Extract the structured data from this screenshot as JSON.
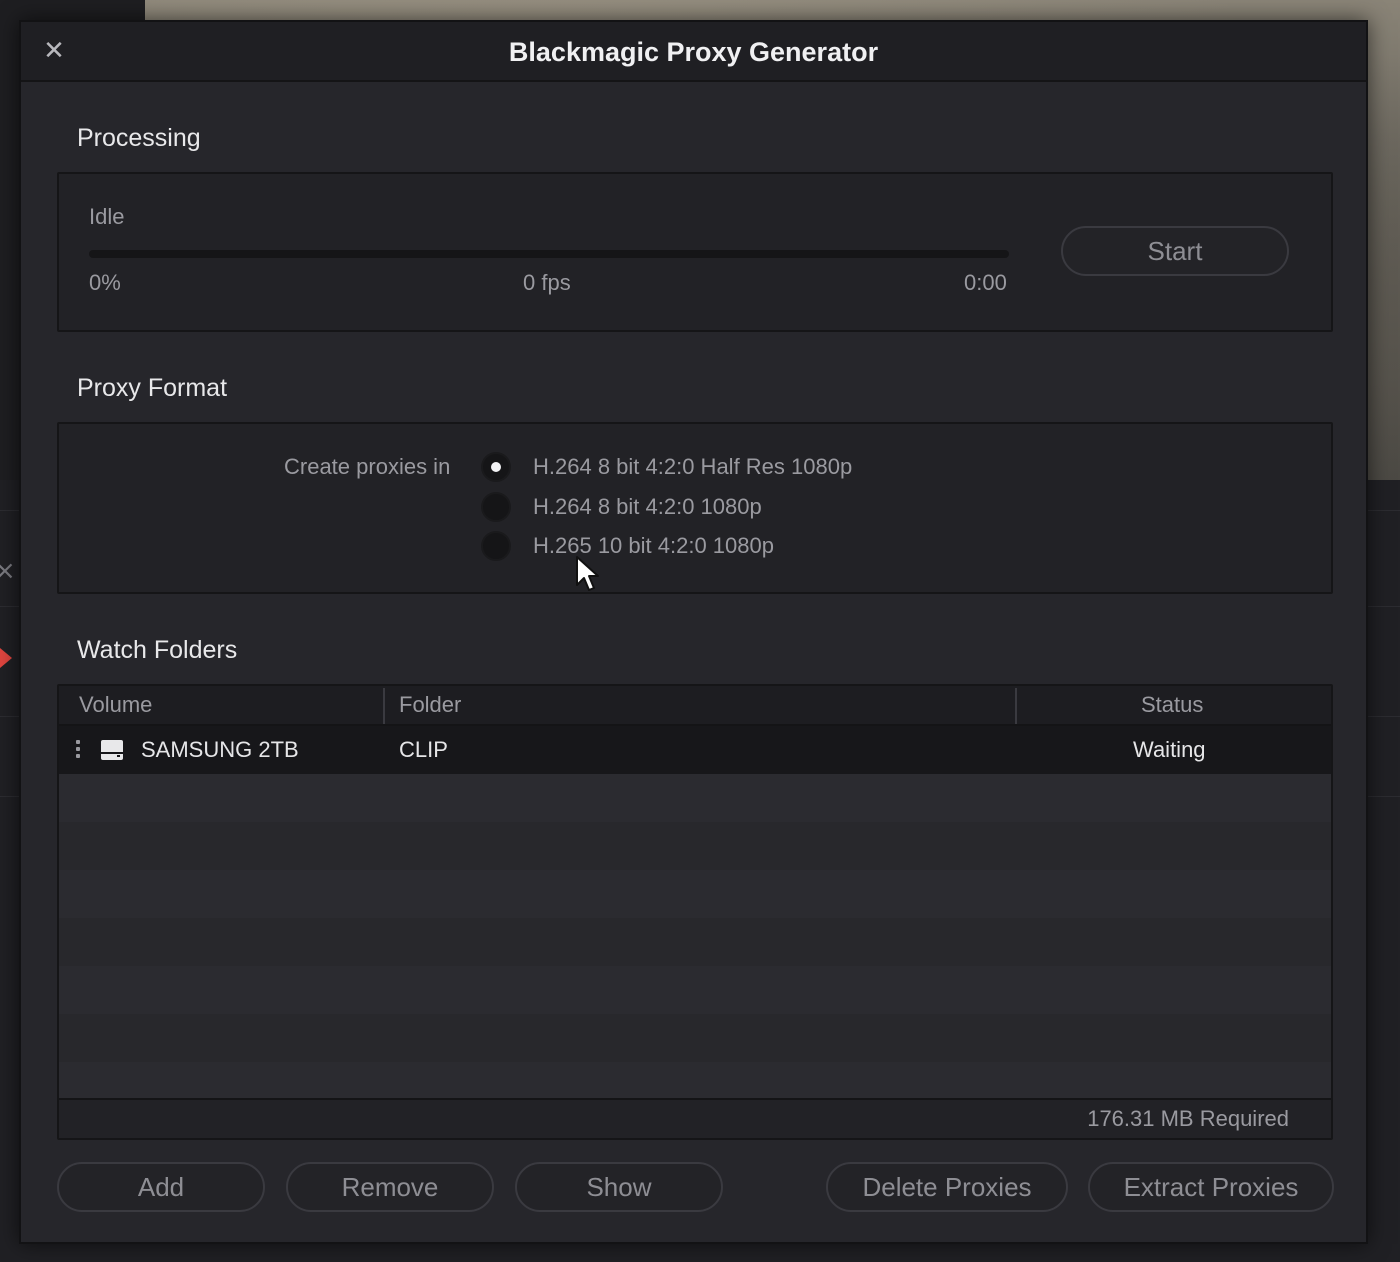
{
  "dialog": {
    "title": "Blackmagic Proxy Generator",
    "close_icon": "close-icon"
  },
  "processing": {
    "section_title": "Processing",
    "status": "Idle",
    "progress_percent_value": 0,
    "progress_percent": "0%",
    "fps": "0 fps",
    "time": "0:00",
    "start_label": "Start"
  },
  "proxy_format": {
    "section_title": "Proxy Format",
    "create_label": "Create proxies in",
    "options": [
      {
        "label": "H.264 8 bit 4:2:0 Half Res 1080p",
        "selected": true
      },
      {
        "label": "H.264 8 bit 4:2:0 1080p",
        "selected": false
      },
      {
        "label": "H.265 10 bit 4:2:0 1080p",
        "selected": false
      }
    ]
  },
  "watch_folders": {
    "section_title": "Watch Folders",
    "columns": [
      "Volume",
      "Folder",
      "Status"
    ],
    "rows": [
      {
        "icon": "drive-icon",
        "volume": "SAMSUNG 2TB",
        "folder": "CLIP",
        "status": "Waiting"
      }
    ],
    "required": "176.31 MB Required"
  },
  "buttons": {
    "add": "Add",
    "remove": "Remove",
    "show": "Show",
    "delete_proxies": "Delete Proxies",
    "extract_proxies": "Extract Proxies"
  },
  "colors": {
    "dialog_bg": "#26262b",
    "titlebar_bg": "#1f1f23",
    "panel_bg": "#222226",
    "text_primary": "#e8e8ea",
    "text_secondary": "#9a9aa0",
    "playhead": "#e0453f"
  }
}
